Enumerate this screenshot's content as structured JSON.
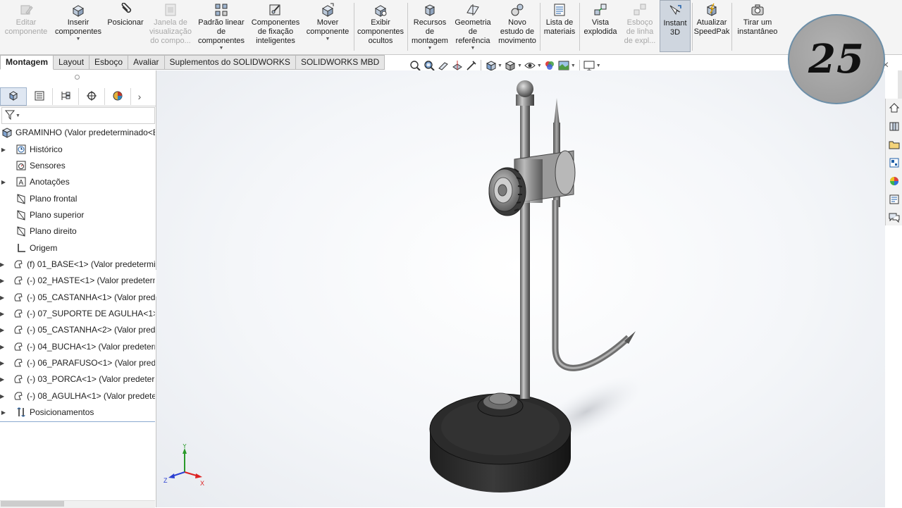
{
  "ribbon": {
    "items": [
      {
        "label": "Editar\ncomponente",
        "enabled": false
      },
      {
        "label": "Inserir\ncomponentes",
        "enabled": true,
        "dropdown": true
      },
      {
        "label": "Posicionar",
        "enabled": true
      },
      {
        "label": "Janela de\nvisualização\ndo compo...",
        "enabled": false
      },
      {
        "label": "Padrão linear\nde\ncomponentes",
        "enabled": true,
        "dropdown": true
      },
      {
        "label": "Componentes\nde fixação\ninteligentes",
        "enabled": true
      },
      {
        "label": "Mover\ncomponente",
        "enabled": true,
        "dropdown": true
      },
      {
        "label": "Exibir\ncomponentes\nocultos",
        "enabled": true
      },
      {
        "label": "Recursos\nde\nmontagem",
        "enabled": true,
        "dropdown": true
      },
      {
        "label": "Geometria\nde\nreferência",
        "enabled": true,
        "dropdown": true
      },
      {
        "label": "Novo\nestudo de\nmovimento",
        "enabled": true
      },
      {
        "label": "Lista de\nmateriais",
        "enabled": true
      },
      {
        "label": "Vista\nexplodida",
        "enabled": true
      },
      {
        "label": "Esboço\nde linha\nde expl...",
        "enabled": false
      },
      {
        "label": "Instant\n3D",
        "enabled": true,
        "active": true
      },
      {
        "label": "Atualizar\nSpeedPak",
        "enabled": true
      },
      {
        "label": "Tirar um\ninstantâneo",
        "enabled": true
      }
    ]
  },
  "tabs": [
    "Montagem",
    "Layout",
    "Esboço",
    "Avaliar",
    "Suplementos do SOLIDWORKS",
    "SOLIDWORKS MBD"
  ],
  "active_tab": "Montagem",
  "tree": {
    "root": "GRAMINHO  (Valor predeterminado<Est",
    "items": [
      {
        "label": "Histórico",
        "expandable": true,
        "icon": "history-icon"
      },
      {
        "label": "Sensores",
        "expandable": false,
        "icon": "sensor-icon"
      },
      {
        "label": "Anotações",
        "expandable": true,
        "icon": "annotation-icon"
      },
      {
        "label": "Plano frontal",
        "expandable": false,
        "icon": "plane-icon"
      },
      {
        "label": "Plano superior",
        "expandable": false,
        "icon": "plane-icon"
      },
      {
        "label": "Plano direito",
        "expandable": false,
        "icon": "plane-icon"
      },
      {
        "label": "Origem",
        "expandable": false,
        "icon": "origin-icon"
      },
      {
        "label": "(f) 01_BASE<1> (Valor predeterminad",
        "expandable": true,
        "icon": "part-icon"
      },
      {
        "label": "(-) 02_HASTE<1> (Valor predetermi",
        "expandable": true,
        "icon": "part-icon"
      },
      {
        "label": "(-) 05_CASTANHA<1> (Valor predet",
        "expandable": true,
        "icon": "part-icon"
      },
      {
        "label": "(-) 07_SUPORTE DE AGULHA<1> (V",
        "expandable": true,
        "icon": "part-icon"
      },
      {
        "label": "(-) 05_CASTANHA<2> (Valor predet",
        "expandable": true,
        "icon": "part-icon"
      },
      {
        "label": "(-) 04_BUCHA<1> (Valor predeterm",
        "expandable": true,
        "icon": "part-icon"
      },
      {
        "label": "(-) 06_PARAFUSO<1> (Valor predet",
        "expandable": true,
        "icon": "part-icon"
      },
      {
        "label": "(-) 03_PORCA<1> (Valor predeterm",
        "expandable": true,
        "icon": "part-icon"
      },
      {
        "label": "(-) 08_AGULHA<1> (Valor predeterr",
        "expandable": true,
        "icon": "part-icon"
      },
      {
        "label": "Posicionamentos",
        "expandable": true,
        "icon": "mates-icon"
      }
    ]
  },
  "badge": "25",
  "triad": {
    "x": "X",
    "y": "Y",
    "z": "Z"
  },
  "colors": {
    "accent": "#1f5fa8",
    "badge": "#a3a3a3",
    "badge_border": "#6d8fa8"
  }
}
